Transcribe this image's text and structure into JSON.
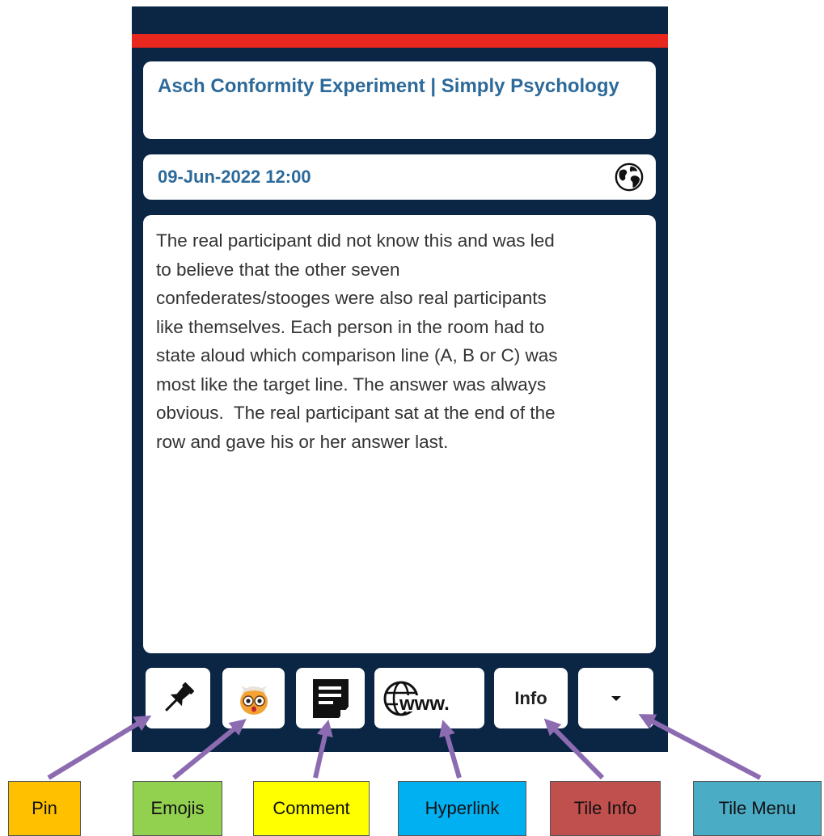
{
  "tile": {
    "title": "Asch Conformity Experiment | Simply Psychology",
    "date": "09-Jun-2022 12:00",
    "body": "The real participant did not know this and was led\nto believe that the other seven\nconfederates/stooges were also real participants\nlike themselves. Each person in the room had to\nstate aloud which comparison line (A, B or C) was\nmost like the target line. The answer was always\nobvious.  The real participant sat at the end of the\nrow and gave his or her answer last."
  },
  "toolbar": {
    "pin_icon": "pushpin-icon",
    "emoji_icon": "owl-emoji-icon",
    "comment_icon": "comment-note-icon",
    "hyperlink_icon": "globe-www-icon",
    "info_label": "Info",
    "menu_icon": "caret-down-icon"
  },
  "legend": {
    "pin": "Pin",
    "emojis": "Emojis",
    "comment": "Comment",
    "hyperlink": "Hyperlink",
    "tile_info": "Tile Info",
    "tile_menu": "Tile Menu"
  },
  "colors": {
    "tile_background": "#0b2545",
    "accent_bar": "#e8281e",
    "title_text": "#2d6a9a",
    "arrow": "#8c6bb1",
    "legend_pin": "#ffc000",
    "legend_emojis": "#92d050",
    "legend_comment": "#ffff00",
    "legend_hyperlink": "#00b0f0",
    "legend_tile_info": "#c0504d",
    "legend_tile_menu": "#4bacc6"
  }
}
